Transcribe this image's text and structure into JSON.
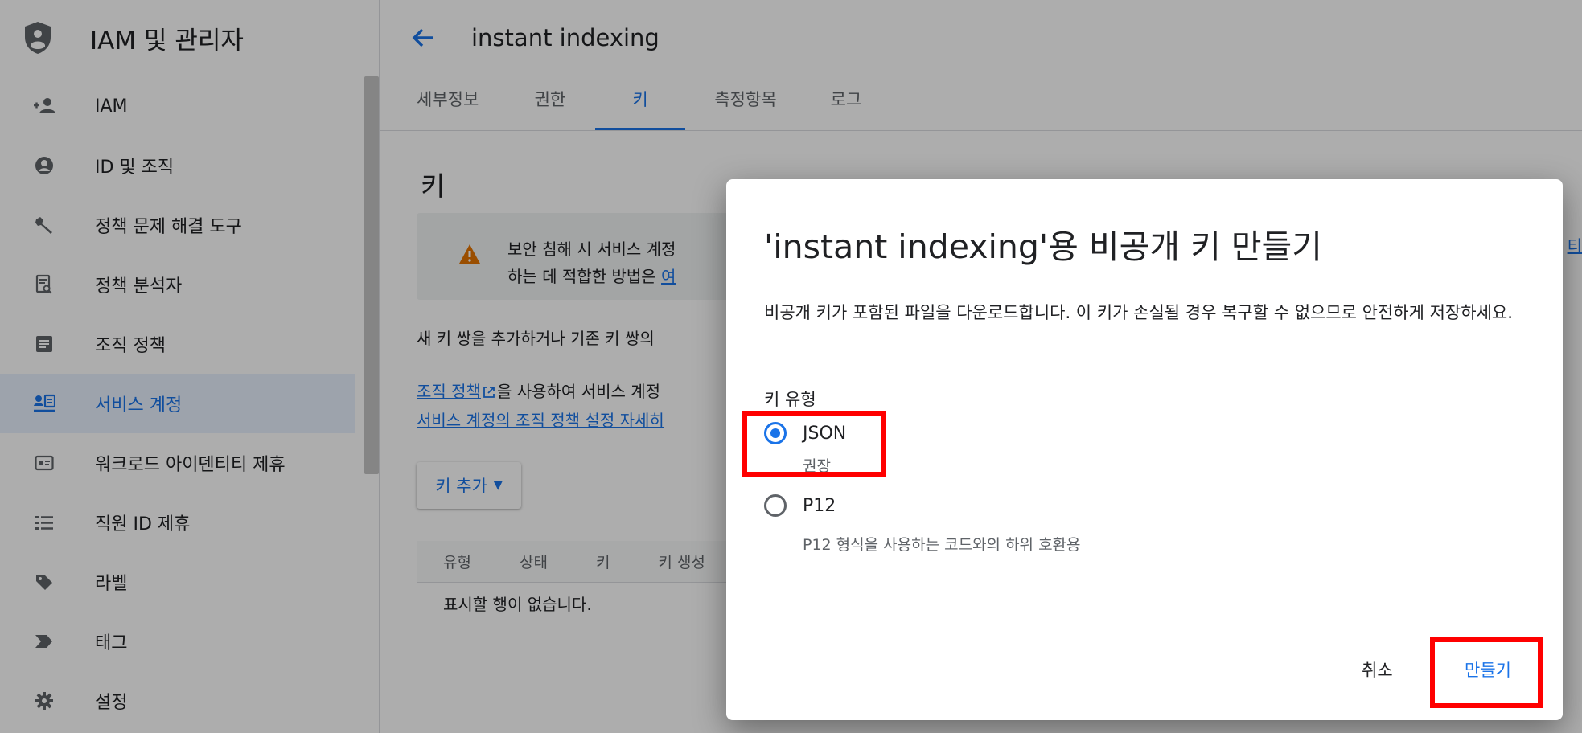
{
  "sidebar": {
    "title": "IAM 및 관리자",
    "items": [
      {
        "label": "IAM",
        "icon": "person-add-icon"
      },
      {
        "label": "ID 및 조직",
        "icon": "account-circle-icon"
      },
      {
        "label": "정책 문제 해결 도구",
        "icon": "wrench-icon"
      },
      {
        "label": "정책 분석자",
        "icon": "document-search-icon"
      },
      {
        "label": "조직 정책",
        "icon": "article-icon"
      },
      {
        "label": "서비스 계정",
        "icon": "service-account-icon",
        "active": true
      },
      {
        "label": "워크로드 아이덴티티 제휴",
        "icon": "id-card-icon"
      },
      {
        "label": "직원 ID 제휴",
        "icon": "list-icon"
      },
      {
        "label": "라벨",
        "icon": "label-icon"
      },
      {
        "label": "태그",
        "icon": "tag-icon"
      },
      {
        "label": "설정",
        "icon": "gear-icon"
      }
    ]
  },
  "header": {
    "title": "instant indexing"
  },
  "tabs": [
    {
      "label": "세부정보"
    },
    {
      "label": "권한"
    },
    {
      "label": "키",
      "active": true
    },
    {
      "label": "측정항목"
    },
    {
      "label": "로그"
    }
  ],
  "main": {
    "section_title": "키",
    "warning_line1": "보안 침해 시 서비스 계정",
    "warning_line2_prefix": "하는 데 적합한 방법은 ",
    "warning_line2_link": "여",
    "right_edge_link": "티",
    "para1": "새 키 쌍을 추가하거나 기존 키 쌍의 ",
    "para2_link": "조직 정책",
    "para2_rest": "을 사용하여 서비스 계정",
    "para2_line2_link": "서비스 계정의 조직 정책 설정 자세히",
    "add_key_label": "키 추가",
    "table_headers": [
      "유형",
      "상태",
      "키",
      "키 생성"
    ],
    "table_empty": "표시할 행이 없습니다."
  },
  "dialog": {
    "title": "'instant indexing'용 비공개 키 만들기",
    "description": "비공개 키가 포함된 파일을 다운로드합니다. 이 키가 손실될 경우 복구할 수 없으므로 안전하게 저장하세요.",
    "key_type_label": "키 유형",
    "options": [
      {
        "label": "JSON",
        "sub": "권장",
        "selected": true
      },
      {
        "label": "P12",
        "sub": "P12 형식을 사용하는 코드와의 하위 호환용",
        "selected": false
      }
    ],
    "cancel_label": "취소",
    "create_label": "만들기"
  },
  "colors": {
    "accent": "#1a73e8",
    "highlight": "#ff0000",
    "warning": "#e37400"
  }
}
